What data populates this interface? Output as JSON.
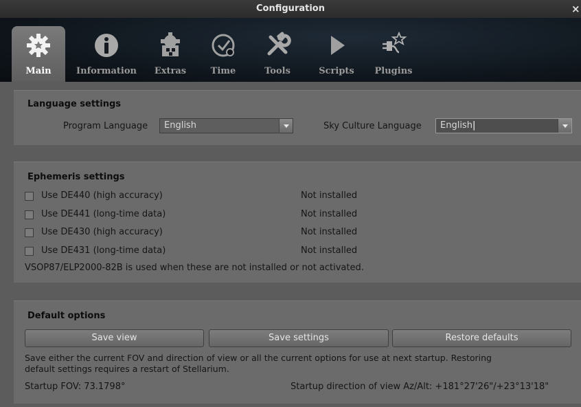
{
  "window": {
    "title": "Configuration",
    "close_glyph": "×"
  },
  "tabs": [
    {
      "label": "Main",
      "icon": "gear-icon",
      "active": true
    },
    {
      "label": "Information",
      "icon": "info-icon",
      "active": false
    },
    {
      "label": "Extras",
      "icon": "puzzle-gear-icon",
      "active": false
    },
    {
      "label": "Time",
      "icon": "clock-icon",
      "active": false
    },
    {
      "label": "Tools",
      "icon": "wrench-screwdriver-icon",
      "active": false
    },
    {
      "label": "Scripts",
      "icon": "play-icon",
      "active": false
    },
    {
      "label": "Plugins",
      "icon": "plug-star-icon",
      "active": false
    }
  ],
  "language": {
    "title": "Language settings",
    "program_label": "Program Language",
    "program_value": "English",
    "sky_label": "Sky Culture Language",
    "sky_value": "English"
  },
  "ephemeris": {
    "title": "Ephemeris settings",
    "items": [
      {
        "label": "Use DE440 (high accuracy)",
        "status": "Not installed",
        "checked": false
      },
      {
        "label": "Use DE441 (long-time data)",
        "status": "Not installed",
        "checked": false
      },
      {
        "label": "Use DE430 (high accuracy)",
        "status": "Not installed",
        "checked": false
      },
      {
        "label": "Use DE431 (long-time data)",
        "status": "Not installed",
        "checked": false
      }
    ],
    "note": "VSOP87/ELP2000-82B is used when these are not installed or not activated."
  },
  "defaults": {
    "title": "Default options",
    "save_view": "Save view",
    "save_settings": "Save settings",
    "restore_defaults": "Restore defaults",
    "description_line1": "Save either the current FOV and direction of view or all the current options for use at next startup. Restoring",
    "description_line2": "default settings requires a restart of Stellarium.",
    "startup_fov": "Startup FOV: 73.1798°",
    "startup_direction": "Startup direction of view Az/Alt: +181°27'26\"/+23°13'18\""
  }
}
